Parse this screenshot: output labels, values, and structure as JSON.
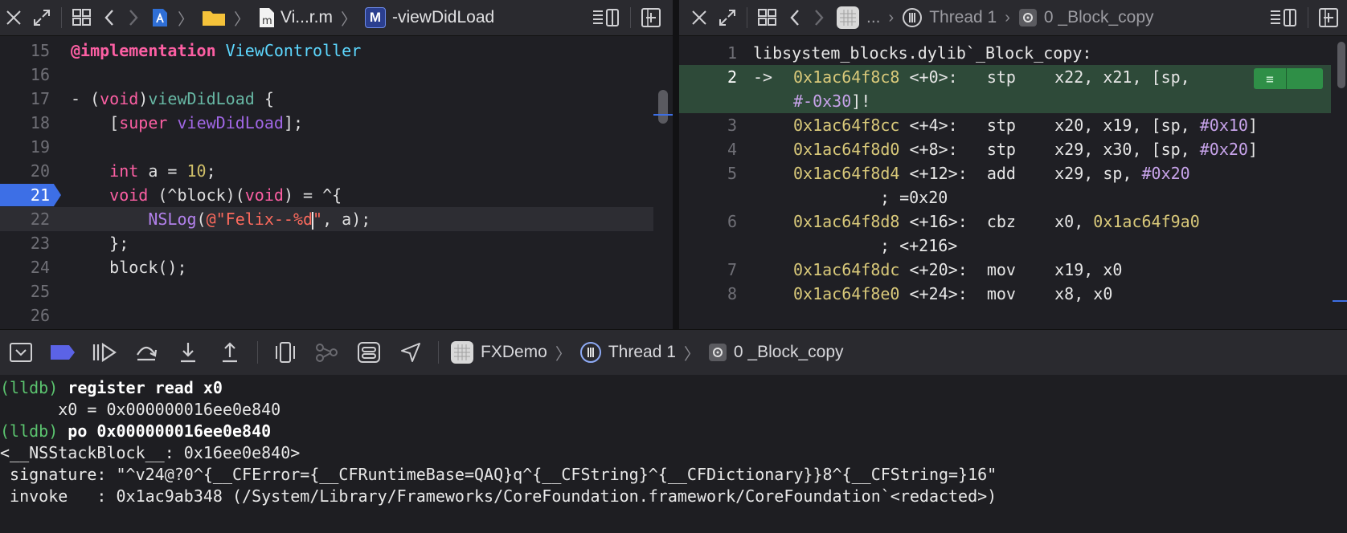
{
  "left_editor": {
    "jumpbar": {
      "file_label": "Vi...r.m",
      "method_badge": "M",
      "method_label": "-viewDidLoad"
    },
    "lines": [
      {
        "num": "15",
        "segments": [
          {
            "t": "@implementation",
            "c": "kw"
          },
          {
            "t": " ",
            "c": ""
          },
          {
            "t": "ViewController",
            "c": "cls"
          }
        ]
      },
      {
        "num": "16",
        "segments": []
      },
      {
        "num": "17",
        "segments": [
          {
            "t": "- (",
            "c": ""
          },
          {
            "t": "void",
            "c": "kwn"
          },
          {
            "t": ")",
            "c": ""
          },
          {
            "t": "viewDidLoad",
            "c": "mth"
          },
          {
            "t": " {",
            "c": ""
          }
        ]
      },
      {
        "num": "18",
        "segments": [
          {
            "t": "    [",
            "c": ""
          },
          {
            "t": "super",
            "c": "kwn"
          },
          {
            "t": " ",
            "c": ""
          },
          {
            "t": "viewDidLoad",
            "c": "sup"
          },
          {
            "t": "];",
            "c": ""
          }
        ]
      },
      {
        "num": "19",
        "segments": []
      },
      {
        "num": "20",
        "segments": [
          {
            "t": "    ",
            "c": ""
          },
          {
            "t": "int",
            "c": "kwn"
          },
          {
            "t": " a = ",
            "c": ""
          },
          {
            "t": "10",
            "c": "num"
          },
          {
            "t": ";",
            "c": ""
          }
        ]
      },
      {
        "num": "21",
        "segments": [
          {
            "t": "    ",
            "c": ""
          },
          {
            "t": "void",
            "c": "kwn"
          },
          {
            "t": " (^block)(",
            "c": ""
          },
          {
            "t": "void",
            "c": "kwn"
          },
          {
            "t": ") = ^{",
            "c": ""
          }
        ],
        "breakpoint": true
      },
      {
        "num": "22",
        "segments": [
          {
            "t": "        ",
            "c": ""
          },
          {
            "t": "NSLog",
            "c": "fn"
          },
          {
            "t": "(",
            "c": ""
          },
          {
            "t": "@\"Felix--%d",
            "c": "str"
          },
          {
            "t": "|",
            "c": "caret"
          },
          {
            "t": "\"",
            "c": "str"
          },
          {
            "t": ", a);",
            "c": ""
          }
        ],
        "current": true
      },
      {
        "num": "23",
        "segments": [
          {
            "t": "    };",
            "c": ""
          }
        ]
      },
      {
        "num": "24",
        "segments": [
          {
            "t": "    block();",
            "c": ""
          }
        ]
      },
      {
        "num": "25",
        "segments": []
      },
      {
        "num": "26",
        "segments": []
      }
    ]
  },
  "right_editor": {
    "jumpbar": {
      "project_label": "...",
      "thread_label": "Thread 1",
      "frame_label": "0 _Block_copy"
    },
    "lines": [
      {
        "num": "1",
        "parts": [
          {
            "t": "libsystem_blocks.dylib`_Block_copy:",
            "c": "plain"
          }
        ]
      },
      {
        "num": "2",
        "pc": true,
        "arrow": "->",
        "parts": [
          {
            "t": "0x1ac64f8c8",
            "c": "addr"
          },
          {
            "t": " <+0>:   ",
            "c": "plain"
          },
          {
            "t": "stp    x22, x21, [sp,",
            "c": "plain"
          }
        ],
        "wrap": [
          {
            "t": "#-0x30",
            "c": "imm"
          },
          {
            "t": "]!",
            "c": "plain"
          }
        ]
      },
      {
        "num": "3",
        "parts": [
          {
            "t": "0x1ac64f8cc",
            "c": "addr"
          },
          {
            "t": " <+4>:   ",
            "c": "plain"
          },
          {
            "t": "stp    x20, x19, [sp, ",
            "c": "plain"
          },
          {
            "t": "#0x10",
            "c": "imm"
          },
          {
            "t": "]",
            "c": "plain"
          }
        ]
      },
      {
        "num": "4",
        "parts": [
          {
            "t": "0x1ac64f8d0",
            "c": "addr"
          },
          {
            "t": " <+8>:   ",
            "c": "plain"
          },
          {
            "t": "stp    x29, x30, [sp, ",
            "c": "plain"
          },
          {
            "t": "#0x20",
            "c": "imm"
          },
          {
            "t": "]",
            "c": "plain"
          }
        ]
      },
      {
        "num": "5",
        "parts": [
          {
            "t": "0x1ac64f8d4",
            "c": "addr"
          },
          {
            "t": " <+12>:  ",
            "c": "plain"
          },
          {
            "t": "add    x29, sp, ",
            "c": "plain"
          },
          {
            "t": "#0x20",
            "c": "imm"
          }
        ],
        "wrap_indent": true,
        "wrap": [
          {
            "t": "; =0x20",
            "c": "plain"
          }
        ]
      },
      {
        "num": "6",
        "parts": [
          {
            "t": "0x1ac64f8d8",
            "c": "addr"
          },
          {
            "t": " <+16>:  ",
            "c": "plain"
          },
          {
            "t": "cbz    x0, ",
            "c": "plain"
          },
          {
            "t": "0x1ac64f9a0",
            "c": "addr"
          }
        ],
        "wrap_indent": true,
        "wrap": [
          {
            "t": "; <+216>",
            "c": "plain"
          }
        ]
      },
      {
        "num": "7",
        "parts": [
          {
            "t": "0x1ac64f8dc",
            "c": "addr"
          },
          {
            "t": " <+20>:  ",
            "c": "plain"
          },
          {
            "t": "mov    x19, x0",
            "c": "plain"
          }
        ]
      },
      {
        "num": "8",
        "parts": [
          {
            "t": "0x1ac64f8e0",
            "c": "addr"
          },
          {
            "t": " <+24>:  ",
            "c": "plain"
          },
          {
            "t": "mov    x8, x0",
            "c": "plain"
          }
        ]
      }
    ]
  },
  "debug_bar": {
    "project_label": "FXDemo",
    "thread_label": "Thread 1",
    "frame_label": "0 _Block_copy"
  },
  "console": {
    "lines": [
      {
        "prompt": "(lldb)",
        "text": " register read x0"
      },
      {
        "text": "      x0 = 0x000000016ee0e840"
      },
      {
        "prompt": "(lldb)",
        "text": " po 0x000000016ee0e840"
      },
      {
        "text": "<__NSStackBlock__: 0x16ee0e840>"
      },
      {
        "text": " signature: \"^v24@?0^{__CFError={__CFRuntimeBase=QAQ}q^{__CFString}^{__CFDictionary}}8^{__CFString=}16\""
      },
      {
        "text": " invoke   : 0x1ac9ab348 (/System/Library/Frameworks/CoreFoundation.framework/CoreFoundation`<redacted>)"
      }
    ]
  },
  "colors": {
    "breakpoint": "#3d6fe6",
    "pc_highlight": "#2e4a39",
    "lldb_prompt": "#5bc46f"
  }
}
